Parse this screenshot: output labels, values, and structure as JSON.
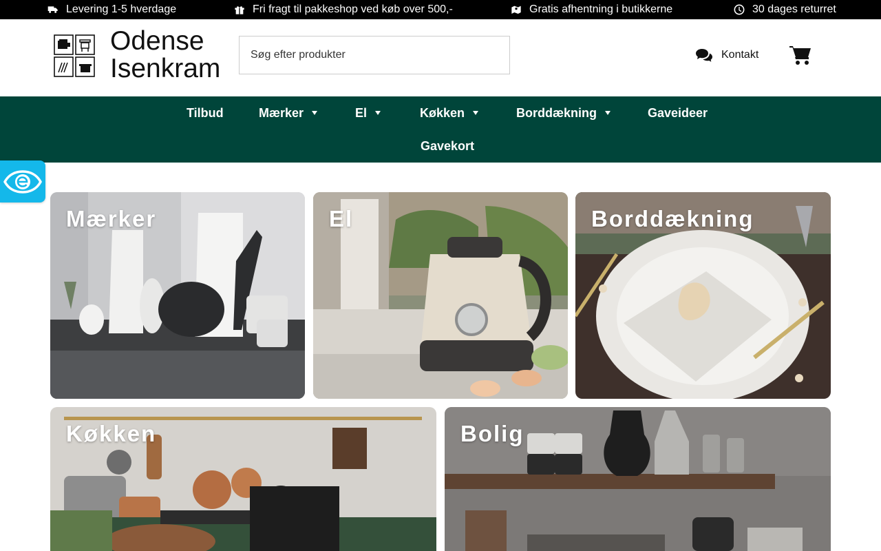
{
  "topbar": {
    "items": [
      {
        "icon": "truck-icon",
        "text": "Levering 1-5 hverdage"
      },
      {
        "icon": "gift-icon",
        "text": "Fri fragt til pakkeshop ved køb over 500,-"
      },
      {
        "icon": "map-pin-icon",
        "text": "Gratis afhentning i butikkerne"
      },
      {
        "icon": "clock-icon",
        "text": "30 dages returret"
      }
    ]
  },
  "header": {
    "logo_line1": "Odense",
    "logo_line2": "Isenkram",
    "search_placeholder": "Søg efter produkter",
    "contact_label": "Kontakt"
  },
  "nav": {
    "items": [
      {
        "label": "Tilbud",
        "has_dropdown": false
      },
      {
        "label": "Mærker",
        "has_dropdown": true
      },
      {
        "label": "El",
        "has_dropdown": true
      },
      {
        "label": "Køkken",
        "has_dropdown": true
      },
      {
        "label": "Borddækning",
        "has_dropdown": true
      },
      {
        "label": "Gaveideer",
        "has_dropdown": false
      },
      {
        "label": "Gavekort",
        "has_dropdown": false
      }
    ]
  },
  "categories": [
    {
      "title": "Mærker"
    },
    {
      "title": "El"
    },
    {
      "title": "Borddækning"
    },
    {
      "title": "Køkken"
    },
    {
      "title": "Bolig"
    }
  ],
  "colors": {
    "topbar_bg": "#000000",
    "nav_bg": "#00453a",
    "accessibility_badge": "#14b8ea"
  }
}
